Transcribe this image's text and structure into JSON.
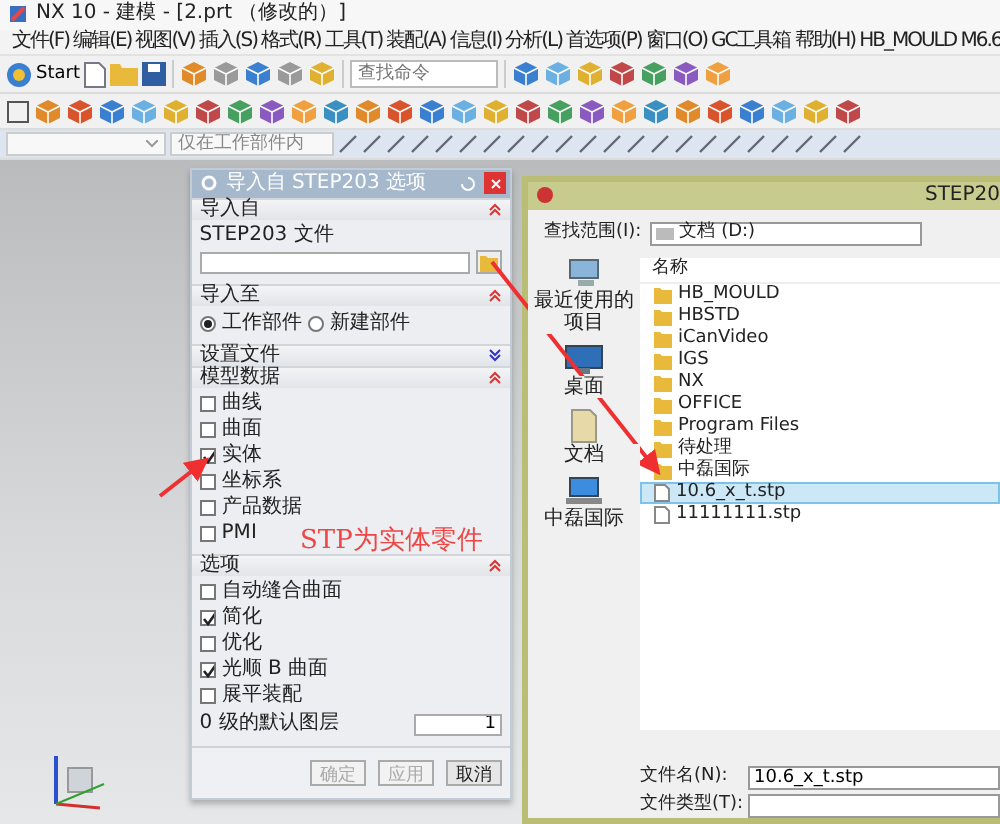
{
  "window": {
    "title": "NX 10 - 建模 - [2.prt （修改的）]"
  },
  "menu": [
    "文件(F)",
    "编辑(E)",
    "视图(V)",
    "插入(S)",
    "格式(R)",
    "工具(T)",
    "装配(A)",
    "信息(I)",
    "分析(L)",
    "首选项(P)",
    "窗口(O)",
    "GC工具箱",
    "帮助(H)",
    "HB_MOULD M6.6"
  ],
  "toolbar": {
    "start_button": "Start",
    "search": {
      "placeholder": "查找命令"
    }
  },
  "selection_bar": {
    "filter": "仅在工作部件内"
  },
  "import_dialog": {
    "title": "导入自 STEP203 选项",
    "sections": [
      {
        "title": "导入自",
        "expanded": true,
        "kind": "file",
        "label": "STEP203 文件"
      },
      {
        "title": "导入至",
        "expanded": true,
        "kind": "radio",
        "options": [
          {
            "label": "工作部件",
            "selected": true
          },
          {
            "label": "新建部件",
            "selected": false
          }
        ]
      },
      {
        "title": "设置文件",
        "expanded": false,
        "kind": "empty"
      },
      {
        "title": "模型数据",
        "expanded": true,
        "kind": "checks",
        "items": [
          {
            "label": "曲线",
            "checked": false
          },
          {
            "label": "曲面",
            "checked": false
          },
          {
            "label": "实体",
            "checked": true
          },
          {
            "label": "坐标系",
            "checked": false
          },
          {
            "label": "产品数据",
            "checked": false
          },
          {
            "label": "PMI",
            "checked": false
          }
        ]
      },
      {
        "title": "选项",
        "expanded": true,
        "kind": "checks",
        "items": [
          {
            "label": "自动缝合曲面",
            "checked": false
          },
          {
            "label": "简化",
            "checked": true
          },
          {
            "label": "优化",
            "checked": false
          },
          {
            "label": "光顺 B 曲面",
            "checked": true
          },
          {
            "label": "展平装配",
            "checked": false
          }
        ],
        "layer": {
          "label": "0 级的默认图层",
          "value": "1"
        }
      }
    ],
    "buttons": [
      {
        "label": "确定",
        "disabled": true
      },
      {
        "label": "应用",
        "disabled": true
      },
      {
        "label": "取消",
        "disabled": false
      }
    ]
  },
  "annotation": "STP为实体零件",
  "file_dialog": {
    "title": "STEP20",
    "look_in_label": "查找范围(I):",
    "look_in": "文档 (D:)",
    "places": [
      {
        "label": "最近使用的项目",
        "kind": "recent"
      },
      {
        "label": "桌面",
        "kind": "desktop"
      },
      {
        "label": "文档",
        "kind": "documents"
      },
      {
        "label": "中磊国际",
        "kind": "computer"
      }
    ],
    "column": "名称",
    "files": [
      {
        "name": "HB_MOULD",
        "kind": "folder",
        "selected": false
      },
      {
        "name": "HBSTD",
        "kind": "folder",
        "selected": false
      },
      {
        "name": "iCanVideo",
        "kind": "folder",
        "selected": false
      },
      {
        "name": "IGS",
        "kind": "folder",
        "selected": false
      },
      {
        "name": "NX",
        "kind": "folder",
        "selected": false
      },
      {
        "name": "OFFICE",
        "kind": "folder",
        "selected": false
      },
      {
        "name": "Program Files",
        "kind": "folder",
        "selected": false
      },
      {
        "name": "待处理",
        "kind": "folder",
        "selected": false
      },
      {
        "name": "中磊国际",
        "kind": "folder",
        "selected": false
      },
      {
        "name": "10.6_x_t.stp",
        "kind": "file",
        "selected": true
      },
      {
        "name": "11111111.stp",
        "kind": "file",
        "selected": false
      }
    ],
    "file_name_label": "文件名(N):",
    "file_name": "10.6_x_t.stp",
    "file_type_label": "文件类型(T):"
  }
}
